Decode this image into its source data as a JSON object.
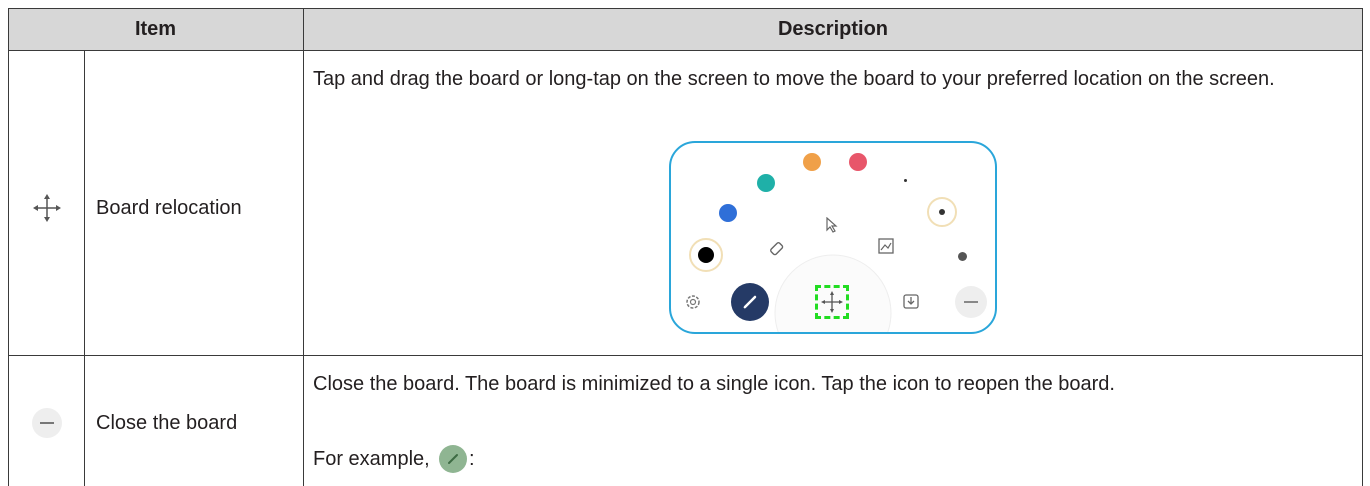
{
  "header": {
    "item_label": "Item",
    "description_label": "Description"
  },
  "rows": [
    {
      "icon": "move-arrows-icon",
      "item": "Board relocation",
      "description": "Tap and drag the board or long-tap on the screen to move the board to your preferred location on the screen."
    },
    {
      "icon": "minus-circle-icon",
      "item": "Close the board",
      "description_line1": "Close the board. The board is minimized to a single icon. Tap the icon to reopen the board.",
      "description_example_prefix": "For example,",
      "description_example_suffix": ":",
      "example_icon": "pen-bubble-icon"
    }
  ],
  "colors": {
    "header_bg": "#d7d7d7",
    "border": "#3a3a3a",
    "board_frame": "#2aa6da",
    "highlight": "#22dd22",
    "palette": [
      "#000000",
      "#2f6fd8",
      "#1fb0a8",
      "#f0a048",
      "#e8566a",
      "#555555"
    ]
  },
  "board_figure_icons": [
    "settings-icon",
    "pen-icon",
    "eraser-icon",
    "cursor-icon",
    "move-arrows-icon",
    "image-icon",
    "download-icon",
    "minus-icon"
  ]
}
